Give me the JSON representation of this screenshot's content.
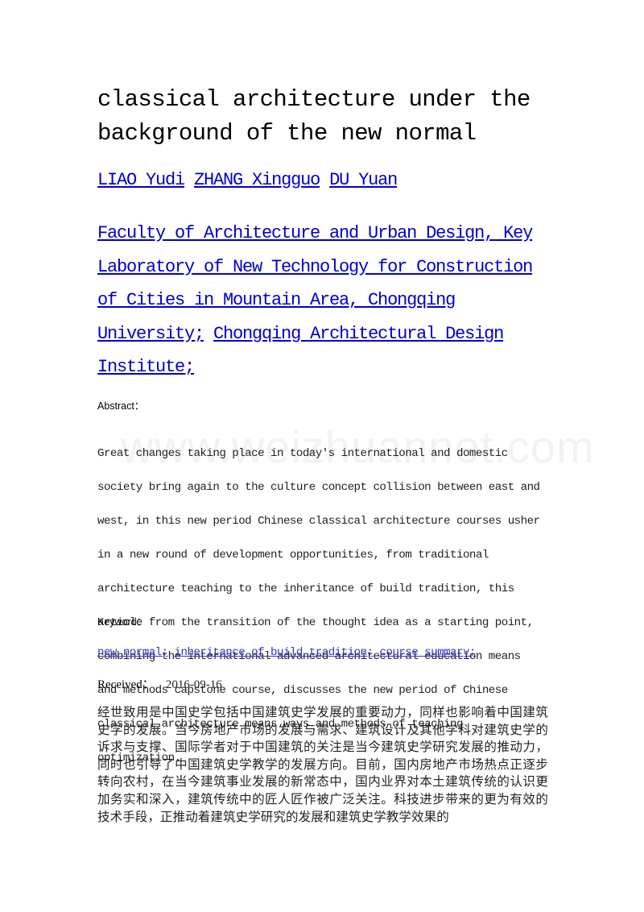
{
  "title_lines": [
    "classical architecture under the",
    "background of the new normal"
  ],
  "authors": [
    "LIAO Yudi",
    "ZHANG Xingguo",
    "DU Yuan"
  ],
  "affiliations": [
    "Faculty of Architecture and Urban Design, Key Laboratory of New Technology for Construction of Cities in Mountain Area, Chongqing University;",
    "Chongqing Architectural Design Institute;"
  ],
  "affiliation_lines": [
    "Faculty of Architecture and Urban Design, Key ",
    "Laboratory of New Technology for Construction ",
    "of Cities in Mountain Area, Chongqing ",
    "University;",
    "Chongqing Architectural Design ",
    "Institute;"
  ],
  "abstract_label": "Abstract：",
  "abstract_lines": [
    "Great changes taking place in today's international and domestic",
    "society bring again to the culture concept collision between east and",
    "west, in this new period Chinese classical architecture courses usher",
    "in a new round of development opportunities, from traditional",
    "architecture teaching to the inheritance of build tradition, this",
    "article from the transition of the thought idea as a starting point,",
    "combining the international advanced architectural education means",
    "and methods capstone course, discusses the new period of Chinese",
    "classical architecture means ways and methods of teaching",
    "optimization."
  ],
  "keyword_label": "Keyword：",
  "keywords": [
    "new normal;",
    "inheritance of build tradition;",
    "course summary;"
  ],
  "received_label": "Received：",
  "received_date": "2016-09-16",
  "body_text": "经世致用是中国史学包括中国建筑史学发展的重要动力，同样也影响着中国建筑史学的发展。当今房地产市场的发展与需求、建筑设计及其他学科对建筑史学的诉求与支撑、国际学者对于中国建筑的关注是当今建筑史学研究发展的推动力，同时也引导了中国建筑史学教学的发展方向。目前，国内房地产市场热点正逐步转向农村，在当今建筑事业发展的新常态中，国内业界对本土建筑传统的认识更加务实和深入，建筑传统中的匠人匠作被广泛关注。科技进步带来的更为有效的技术手段，正推动着建筑史学研究的发展和建筑史学教学效果的",
  "watermark": "www.weizhuannet.com"
}
